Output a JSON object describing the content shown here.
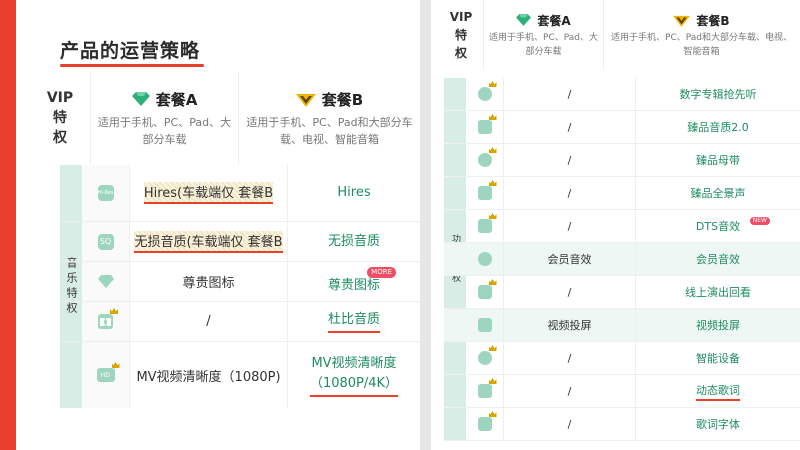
{
  "slide_title": "产品的运营策略",
  "header": {
    "vip_label": [
      "VIP",
      "特",
      "权"
    ],
    "plan_a": {
      "name": "套餐A",
      "desc": "适用于手机、PC、Pad、大部分车载"
    },
    "plan_b": {
      "name": "套餐B",
      "desc": "适用于手机、PC、Pad和大部分车载、电视、智能音箱"
    }
  },
  "left_table": {
    "category": "音乐特权",
    "rows": [
      {
        "icon": "hires-icon",
        "icon_text": "Hi-Res",
        "a": "Hires(车载端仅 套餐B",
        "b": "Hires"
      },
      {
        "icon": "sq-icon",
        "icon_text": "SQ",
        "a": "无损音质(车载端仅 套餐B",
        "b": "无损音质"
      },
      {
        "icon": "diamond-icon",
        "icon_text": "",
        "a": "尊贵图标",
        "b": "尊贵图标",
        "b_badge": "MORE"
      },
      {
        "icon": "dolby-icon",
        "icon_text": "",
        "a": "/",
        "b": "杜比音质"
      },
      {
        "icon": "mv-hd-icon",
        "icon_text": "HD",
        "a": "MV视频清晰度（1080P)",
        "b": "MV视频清晰度",
        "b2": "（1080P/4K）"
      }
    ]
  },
  "right_table": {
    "category": "功能特权",
    "rows": [
      {
        "icon": "headphone-icon",
        "a": "/",
        "b": "数字专辑抢先听"
      },
      {
        "icon": "quality-icon",
        "a": "/",
        "b": "臻品音质2.0"
      },
      {
        "icon": "disc-icon",
        "a": "/",
        "b": "臻品母带"
      },
      {
        "icon": "surround-icon",
        "a": "/",
        "b": "臻品全景声"
      },
      {
        "icon": "dts-icon",
        "a": "/",
        "b": "DTS音效",
        "badge": "NEW"
      },
      {
        "icon": "member-sound-icon",
        "a": "会员音效",
        "b": "会员音效"
      },
      {
        "icon": "replay-icon",
        "a": "/",
        "b": "线上演出回看"
      },
      {
        "icon": "cast-icon",
        "a": "视频投屏",
        "b": "视频投屏"
      },
      {
        "icon": "smart-device-icon",
        "a": "/",
        "b": "智能设备"
      },
      {
        "icon": "lyrics-icon",
        "a": "/",
        "b": "动态歌词"
      },
      {
        "icon": "font-icon",
        "a": "/",
        "b": "歌词字体"
      }
    ]
  },
  "colors": {
    "accent_red": "#e8402f",
    "green_text": "#1e8c5f",
    "strip_green": "#d8ede5",
    "icon_green": "#9ed5bf",
    "gold": "#d9a400"
  }
}
